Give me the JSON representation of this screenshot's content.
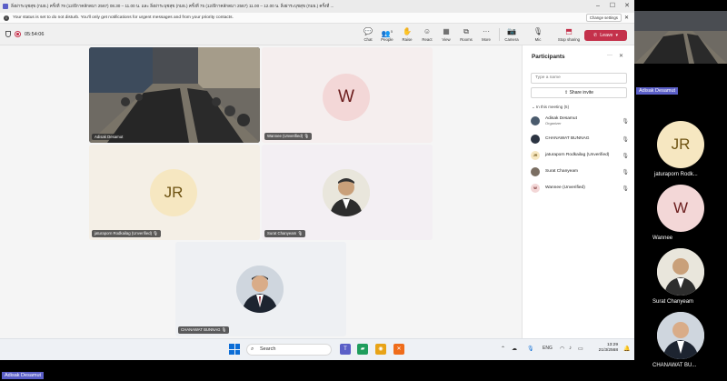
{
  "window": {
    "title": "ลิ่งผ่าระบุชสุข (กมธ.) ครั้งที่ 79 (12/ธีกาคลักดมา 2567) 08.30 – 11.00 น. และ ลิ่งผ่าระบุชสุข (กมธ.) ครั้งที่ 75 (12/ธีกาคลักดมา 2567) 11.00 – 12.00 น. ลิ่งผ่าระบุชสุข (กมธ.) ครั้งที่ ..."
  },
  "notification": {
    "text": "Your status is set to do not disturb. You'll only get notifications for urgent messages and from your priority contacts.",
    "button": "Change settings"
  },
  "toolbar": {
    "timer": "05:54:06",
    "items": [
      {
        "label": "Chat",
        "icon": "chat-icon"
      },
      {
        "label": "People",
        "icon": "people-icon",
        "badge": "5"
      },
      {
        "label": "Raise",
        "icon": "raise-hand-icon"
      },
      {
        "label": "React",
        "icon": "react-icon"
      },
      {
        "label": "View",
        "icon": "view-icon"
      },
      {
        "label": "Rooms",
        "icon": "rooms-icon"
      },
      {
        "label": "More",
        "icon": "more-icon"
      },
      {
        "label": "Camera",
        "icon": "camera-icon"
      },
      {
        "label": "Mic",
        "icon": "mic-icon"
      },
      {
        "label": "Stop sharing",
        "icon": "share-icon"
      }
    ],
    "leave": "Leave"
  },
  "tiles": [
    {
      "name": "Adisak Desamut",
      "type": "video"
    },
    {
      "name": "Wannee (Unverified)",
      "initials": "W",
      "type": "avatar"
    },
    {
      "name": "jaturaporn Rodkailag (Unverified)",
      "initials": "JR",
      "type": "avatar"
    },
    {
      "name": "Surat Chanyeam",
      "type": "photo"
    },
    {
      "name": "CHANAWAT BUNNAG",
      "type": "photo"
    }
  ],
  "participants": {
    "title": "Participants",
    "search_placeholder": "Type a name",
    "share_invite": "Share invite",
    "section": "In this meeting (5)",
    "list": [
      {
        "name": "Adisak Desamut",
        "role": "Organizer",
        "mic": "on"
      },
      {
        "name": "CHANAWAT BUNNAG",
        "role": "",
        "mic": "off"
      },
      {
        "name": "jaturaporn Rodkailag (Unverified)",
        "role": "",
        "mic": "off",
        "initials": "JR"
      },
      {
        "name": "Surat Chanyeam",
        "role": "",
        "mic": "off"
      },
      {
        "name": "Wannee (Unverified)",
        "role": "",
        "mic": "off",
        "initials": "W"
      }
    ]
  },
  "taskbar": {
    "search": "Search",
    "language": "ENG",
    "time": "13:29",
    "date": "21/3/2568"
  },
  "right_strip": {
    "top_name": "Adisak Desamut",
    "items": [
      {
        "name": "jaturaporn Rodk...",
        "initials": "JR"
      },
      {
        "name": "Wannee",
        "initials": "W"
      },
      {
        "name": "Surat Chanyeam",
        "initials": ""
      },
      {
        "name": "CHANAWAT BU...",
        "initials": ""
      }
    ],
    "bottom_name": "Adisak Desamut"
  },
  "colors": {
    "accent": "#5b5fc7",
    "leave": "#c4314b",
    "jr_avatar": "#f6e7c1",
    "w_avatar": "#f3d7d7"
  }
}
